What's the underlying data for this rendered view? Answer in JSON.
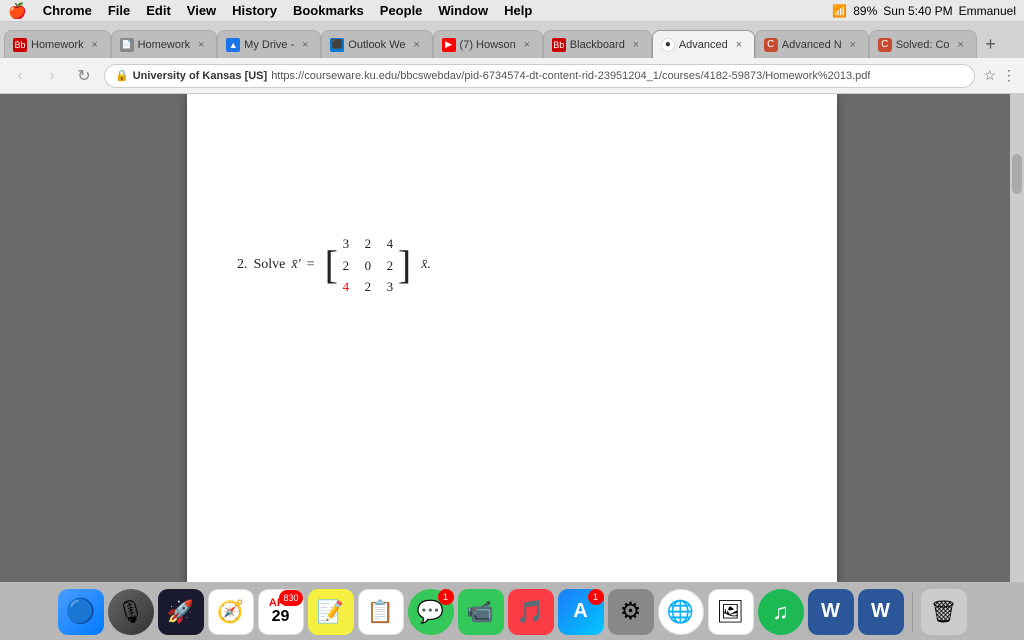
{
  "menubar": {
    "apple": "🍎",
    "app_name": "Chrome",
    "items": [
      "File",
      "Edit",
      "View",
      "History",
      "Bookmarks",
      "People",
      "Window",
      "Help"
    ],
    "right": {
      "wifi": "📶",
      "battery": "89%",
      "time": "Sun 5:40 PM"
    }
  },
  "tabs": [
    {
      "id": "tab1",
      "favicon_color": "#c00",
      "favicon_text": "Bb",
      "label": "Homework",
      "active": false
    },
    {
      "id": "tab2",
      "favicon_color": "#666",
      "favicon_text": "📄",
      "label": "Homework",
      "active": false
    },
    {
      "id": "tab3",
      "favicon_color": "#1a73e8",
      "favicon_text": "▲",
      "label": "My Drive -",
      "active": false
    },
    {
      "id": "tab4",
      "favicon_color": "#0078d7",
      "favicon_text": "⬛",
      "label": "Outlook We",
      "active": false
    },
    {
      "id": "tab5",
      "favicon_color": "#f00",
      "favicon_text": "▶",
      "label": "(7) Howson",
      "active": false
    },
    {
      "id": "tab6",
      "favicon_color": "#c00",
      "favicon_text": "Bb",
      "label": "Blackboard",
      "active": false
    },
    {
      "id": "tab7",
      "favicon_color": "#c84b31",
      "favicon_text": "C",
      "label": "Advanced",
      "active": true
    },
    {
      "id": "tab8",
      "favicon_color": "#c84b31",
      "favicon_text": "C",
      "label": "Advanced N",
      "active": false
    },
    {
      "id": "tab9",
      "favicon_color": "#c84b31",
      "favicon_text": "C",
      "label": "Solved: Co",
      "active": false
    }
  ],
  "addressbar": {
    "site_name": "University of Kansas [US]",
    "url": "https://courseware.ku.edu/bbcswebdav/pid-6734574-dt-content-rid-23951204_1/courses/4182-59873/Homework%2013.pdf"
  },
  "pdf": {
    "problem_number": "2.",
    "problem_text": "Solve",
    "variable": "x̄′",
    "equals": "=",
    "matrix": [
      [
        "3",
        "2",
        "4"
      ],
      [
        "2",
        "0",
        "2"
      ],
      [
        "4",
        "2",
        "3"
      ]
    ],
    "red_row": 2,
    "after": "x̄."
  },
  "dock_icons": [
    {
      "label": "Finder",
      "symbol": "🔵",
      "bg": "#4a9eff"
    },
    {
      "label": "Siri",
      "symbol": "🎙",
      "bg": "#666"
    },
    {
      "label": "Launchpad",
      "symbol": "🚀",
      "bg": "#1a1a2e"
    },
    {
      "label": "Safari",
      "symbol": "🧭",
      "bg": "#1a73e8"
    },
    {
      "label": "Calendar",
      "symbol": "📅",
      "bg": "#fff",
      "badge": "830"
    },
    {
      "label": "Calendar2",
      "symbol": "29",
      "bg": "#fff"
    },
    {
      "label": "Notes",
      "symbol": "📝",
      "bg": "#f5f500"
    },
    {
      "label": "Reminders",
      "symbol": "☰",
      "bg": "#fff"
    },
    {
      "label": "Messages",
      "symbol": "💬",
      "bg": "#34c759",
      "badge": "1"
    },
    {
      "label": "FaceTime",
      "symbol": "📷",
      "bg": "#34c759"
    },
    {
      "label": "Music",
      "symbol": "🎵",
      "bg": "#fc3c44"
    },
    {
      "label": "App Store",
      "symbol": "A",
      "bg": "#1c7cf9",
      "badge": "1"
    },
    {
      "label": "System Prefs",
      "symbol": "⚙",
      "bg": "#888"
    },
    {
      "label": "Chrome",
      "symbol": "●",
      "bg": "#fff"
    },
    {
      "label": "Photos",
      "symbol": "🖼",
      "bg": "#fff"
    },
    {
      "label": "Spotify",
      "symbol": "♫",
      "bg": "#1db954"
    },
    {
      "label": "Word",
      "symbol": "W",
      "bg": "#2b579a"
    },
    {
      "label": "Word2",
      "symbol": "W",
      "bg": "#2b579a"
    },
    {
      "label": "Trash",
      "symbol": "🗑",
      "bg": "#ccc"
    }
  ],
  "user": "Emmanuel"
}
